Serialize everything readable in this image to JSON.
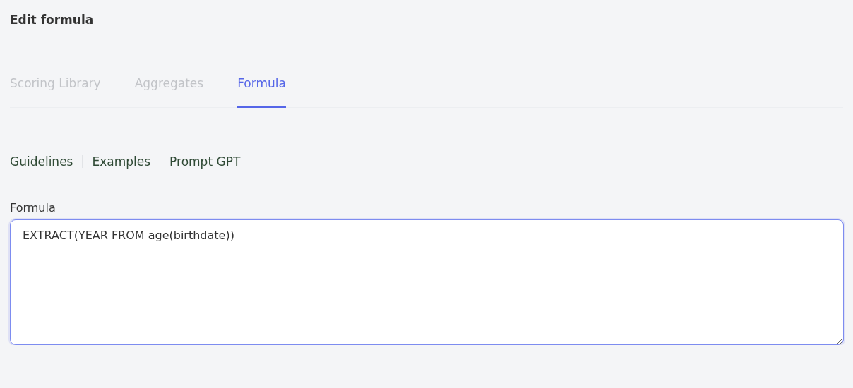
{
  "title": "Edit formula",
  "tabs": [
    {
      "label": "Scoring Library",
      "selected": false
    },
    {
      "label": "Aggregates",
      "selected": false
    },
    {
      "label": "Formula",
      "selected": true
    }
  ],
  "links": [
    "Guidelines",
    "Examples",
    "Prompt GPT"
  ],
  "formula": {
    "label": "Formula",
    "value": "EXTRACT(YEAR FROM age(birthdate))",
    "focused": true
  }
}
